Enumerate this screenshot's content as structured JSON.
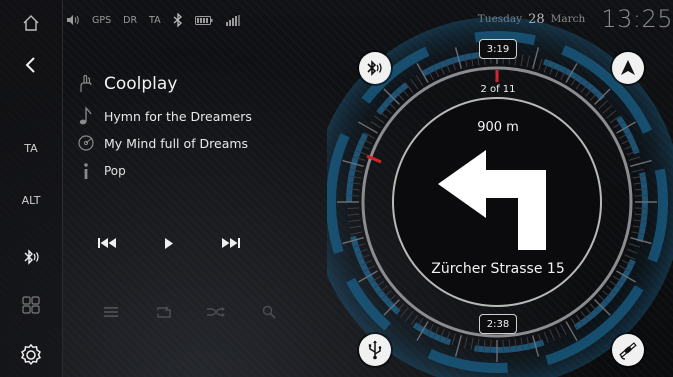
{
  "status_bar": {
    "items": [
      "GPS",
      "DR",
      "TA"
    ],
    "icons": [
      "home-icon",
      "volume-icon",
      "bluetooth-icon",
      "battery-icon",
      "signal-icon"
    ]
  },
  "datetime": {
    "weekday": "Tuesday",
    "day": "28",
    "month": "March",
    "time": "13:25"
  },
  "sidebar": {
    "items": [
      {
        "label": "TA"
      },
      {
        "label": "ALT"
      }
    ],
    "icons": [
      "back-icon",
      "bluetooth-audio-icon",
      "apps-grid-icon",
      "settings-gear-icon"
    ]
  },
  "media": {
    "artist": "Coolplay",
    "album": "Hymn for the Dreamers",
    "track": "My Mind full of Dreams",
    "genre": "Pop",
    "transport": [
      "previous-icon",
      "play-icon",
      "next-icon"
    ],
    "tools": [
      "list-icon",
      "repeat-icon",
      "shuffle-icon",
      "search-icon"
    ]
  },
  "navigation": {
    "time_remaining_top": "3:19",
    "route_progress": "2 of 11",
    "distance": "900 m",
    "turn": "left",
    "street": "Zürcher Strasse 15",
    "time_remaining_bottom": "2:38",
    "buttons": [
      "bluetooth-audio-icon",
      "navigation-arrow-icon",
      "usb-icon",
      "satellite-icon"
    ]
  },
  "colors": {
    "accent_blue": "#1f6f9e",
    "marker_red": "#d3242c",
    "text": "#f2f2f2"
  }
}
